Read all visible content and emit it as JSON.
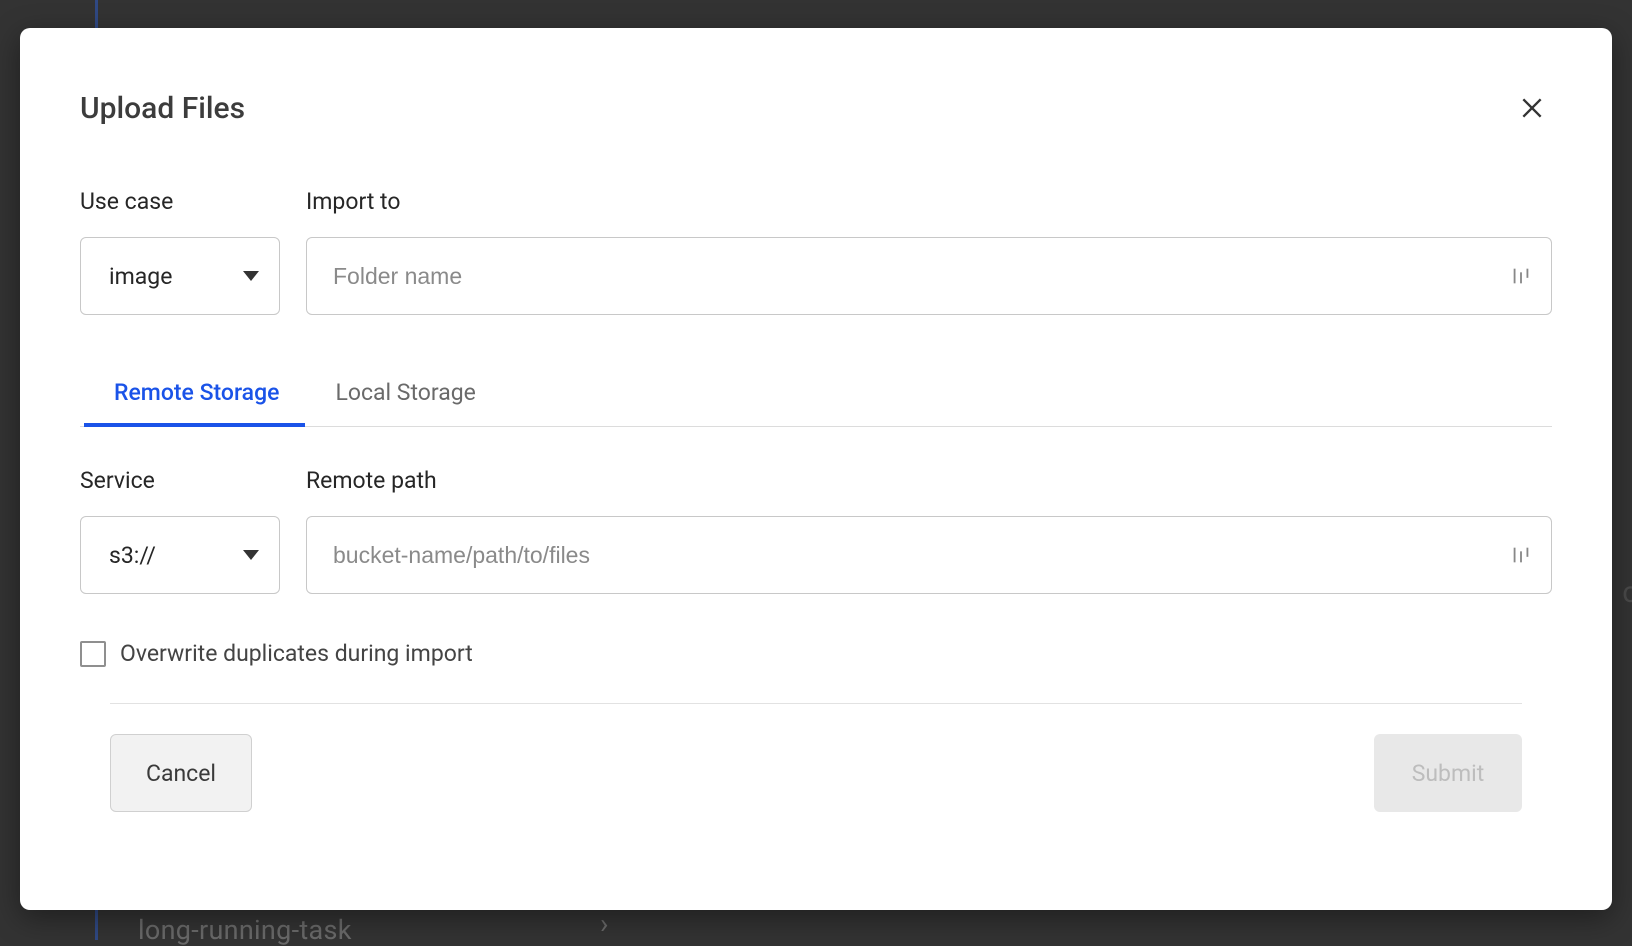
{
  "bg": {
    "item_hint": "long-running-task",
    "right_letter": "c"
  },
  "modal": {
    "title": "Upload Files"
  },
  "useCase": {
    "label": "Use case",
    "value": "image"
  },
  "importTo": {
    "label": "Import to",
    "placeholder": "Folder name",
    "value": ""
  },
  "tabs": {
    "remote": "Remote Storage",
    "local": "Local Storage",
    "active": "remote"
  },
  "service": {
    "label": "Service",
    "value": "s3://"
  },
  "remotePath": {
    "label": "Remote path",
    "placeholder": "bucket-name/path/to/files",
    "value": ""
  },
  "overwrite": {
    "label": "Overwrite duplicates during import",
    "checked": false
  },
  "footer": {
    "cancel": "Cancel",
    "submit": "Submit"
  }
}
